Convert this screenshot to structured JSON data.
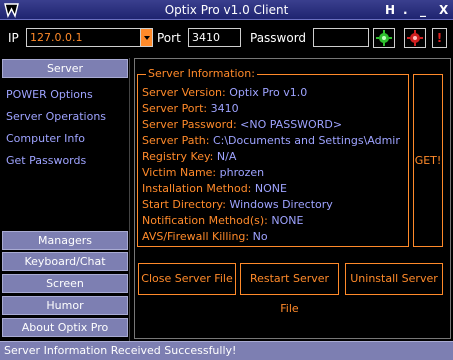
{
  "window": {
    "title": "Optix Pro v1.0 Client",
    "controls": {
      "help": "H",
      "dot": ".",
      "minimize": "_",
      "close": "X"
    }
  },
  "toolbar": {
    "ip_label": "IP",
    "ip_value": "127.0.0.1",
    "port_label": "Port",
    "port_value": "3410",
    "password_label": "Password",
    "password_value": "",
    "disconnect_label": "!"
  },
  "sidebar": {
    "server_button": "Server",
    "links": [
      "POWER Options",
      "Server Operations",
      "Computer Info",
      "Get Passwords"
    ],
    "buttons": [
      "Managers",
      "Keyboard/Chat",
      "Screen",
      "Humor",
      "About Optix Pro"
    ]
  },
  "server_info": {
    "title": "Server Information:",
    "rows": [
      {
        "key": "Server Version:",
        "value": "Optix Pro v1.0"
      },
      {
        "key": "Server Port:",
        "value": "3410"
      },
      {
        "key": "Server Password:",
        "value": "<NO PASSWORD>"
      },
      {
        "key": "Server Path:",
        "value": "C:\\Documents and Settings\\Administrat"
      },
      {
        "key": "Registry Key:",
        "value": "N/A"
      },
      {
        "key": "Victim Name:",
        "value": "phrozen"
      },
      {
        "key": "Installation Method:",
        "value": "NONE"
      },
      {
        "key": "Start Directory:",
        "value": "Windows Directory"
      },
      {
        "key": "Notification Method(s):",
        "value": "NONE"
      },
      {
        "key": "AVS/Firewall Killing:",
        "value": "No"
      }
    ],
    "get_button": "GET!"
  },
  "actions": {
    "close": "Close Server File",
    "restart": "Restart Server File",
    "uninstall": "Uninstall Server"
  },
  "status": {
    "text": "Server Information Received Successfully!"
  },
  "colors": {
    "accent": "#ff8a2a",
    "value_text": "#9ea3ff",
    "side_button": "#7d7fb2",
    "titlebar": "#2b3080"
  }
}
